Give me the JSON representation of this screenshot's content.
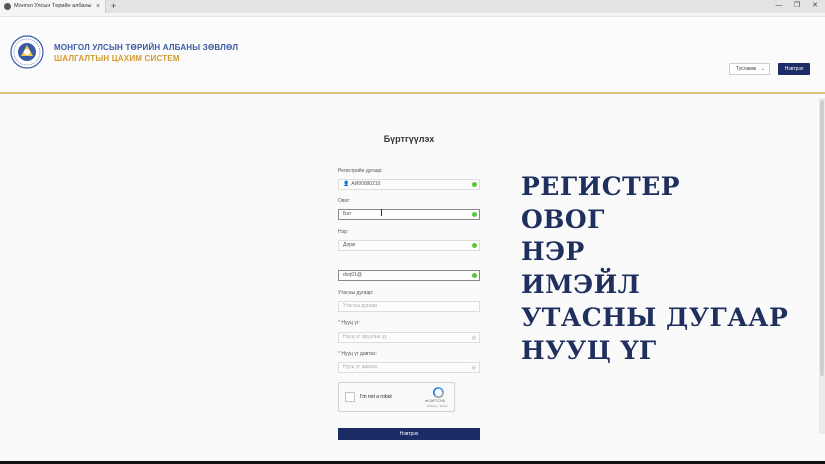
{
  "browser": {
    "tab_title": "Монгол Улсын Төрийн албаны",
    "tab_close": "×",
    "new_tab": "+",
    "minimize": "—",
    "restore": "❐",
    "close": "✕"
  },
  "header": {
    "org_line1": "МОНГОЛ УЛСЫН ТӨРИЙН АЛБАНЫ ЗӨВЛӨЛ",
    "org_line2": "ШАЛГАЛТЫН ЦАХИМ СИСТЕМ",
    "help_label": "Тусламж",
    "login_label": "Нэвтрэх"
  },
  "form": {
    "title": "Бүртгүүлэх",
    "fields": [
      {
        "label": "Регистрийн дугаар:",
        "value": "АИ90080210",
        "status": "ok"
      },
      {
        "label": "Овог:",
        "value": "Бат",
        "status": "ok"
      },
      {
        "label": "Нэр:",
        "value": "Дорж",
        "status": "ok"
      },
      {
        "label": "",
        "value": "dorj01@",
        "status": "ok"
      },
      {
        "label": "Утасны дугаар:",
        "placeholder": "Утасны дугаар"
      },
      {
        "label": "Нууц үг:",
        "required": true,
        "placeholder": "Нууц үг оруулна уу"
      },
      {
        "label": "Нууц үг давтах:",
        "required": true,
        "placeholder": "Нууц үг давтах"
      }
    ],
    "required_mark": "*",
    "captcha": {
      "label": "I'm not a robot",
      "brand": "reCAPTCHA",
      "terms": "Privacy - Terms"
    },
    "submit_label": "Нэвтрэх"
  },
  "annotation": {
    "lines": [
      "РЕГИСТЕР",
      "ОВОГ",
      "НЭР",
      "ИМЭЙЛ",
      "УТАСНЫ ДУГААР",
      "НУУЦ ҮГ"
    ]
  },
  "colors": {
    "navy": "#1c2c66",
    "gold": "#d49a2c",
    "blue": "#3a5aa5",
    "valid": "#5ac53a"
  }
}
